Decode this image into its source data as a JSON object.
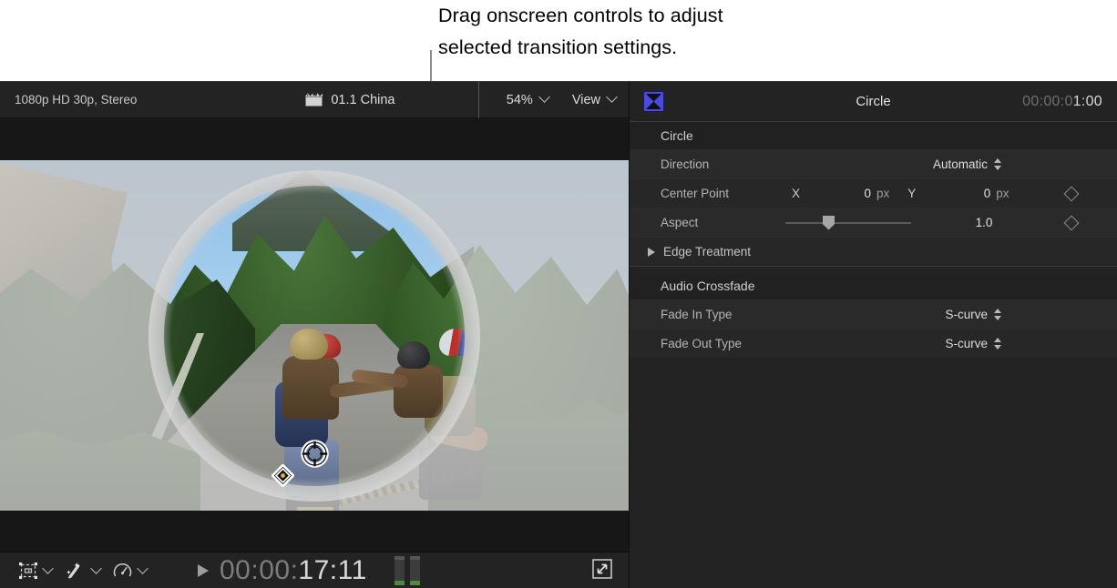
{
  "callout": {
    "line1": "Drag onscreen controls to adjust",
    "line2": "selected transition settings."
  },
  "viewer": {
    "topbar": {
      "resolution": "1080p HD 30p, Stereo",
      "clip_icon": "clapperboard-icon",
      "clip_name": "01.1 China",
      "zoom_level": "54%",
      "view_label": "View"
    },
    "bottombar": {
      "transform_icon": "transform-tool-icon",
      "enhance_icon": "magic-wand-icon",
      "retime_icon": "retime-speedometer-icon",
      "play_icon": "play-triangle-icon",
      "timecode_dim": "00:00:",
      "timecode_lit": "17:11",
      "expand_icon": "expand-arrows-icon"
    },
    "onscreen": {
      "center_handle": "center-point-crosshair-handle",
      "aspect_handle": "aspect-diamond-handle"
    }
  },
  "inspector": {
    "header": {
      "icon": "transition-bowtie-icon",
      "title": "Circle",
      "timecode_dim": "00:00:0",
      "timecode_lit": "1:00"
    },
    "sections": [
      {
        "title": "Circle",
        "rows": [
          {
            "label": "Direction",
            "type": "popup",
            "value": "Automatic"
          },
          {
            "label": "Center Point",
            "type": "xy",
            "x_axis": "X",
            "x_value": "0",
            "x_unit": "px",
            "y_axis": "Y",
            "y_value": "0",
            "y_unit": "px",
            "keyframe": "keyframe-diamond-icon"
          },
          {
            "label": "Aspect",
            "type": "slider",
            "value": "1.0",
            "keyframe": "keyframe-diamond-icon"
          },
          {
            "label": "Edge Treatment",
            "type": "disclosure"
          }
        ]
      },
      {
        "title": "Audio Crossfade",
        "rows": [
          {
            "label": "Fade In Type",
            "type": "popup",
            "value": "S-curve"
          },
          {
            "label": "Fade Out Type",
            "type": "popup",
            "value": "S-curve"
          }
        ]
      }
    ]
  },
  "colors": {
    "accent": "#4a4ae0",
    "panel_bg": "#232323",
    "row_bg": "#2a2a2a",
    "text": "#dcdcdc"
  }
}
